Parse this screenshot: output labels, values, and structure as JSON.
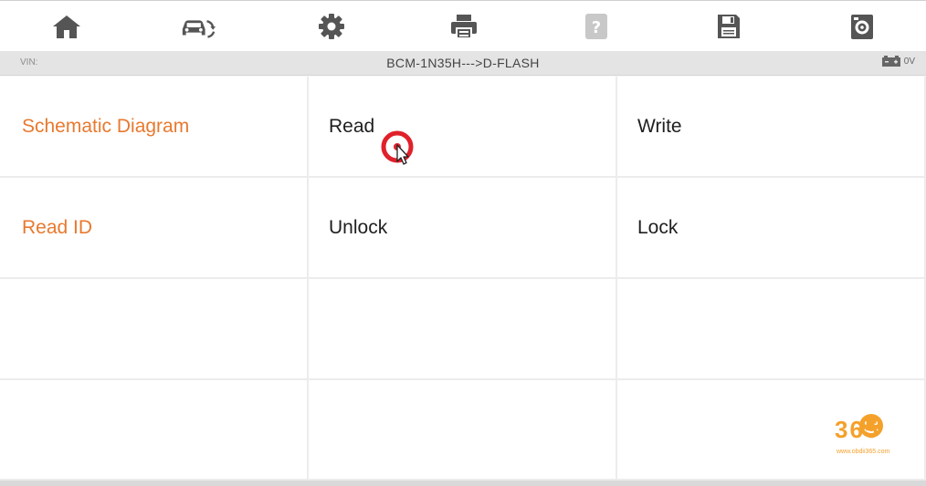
{
  "toolbar": {
    "items": [
      {
        "name": "home-icon",
        "enabled": true
      },
      {
        "name": "vehicle-swap-icon",
        "enabled": true
      },
      {
        "name": "settings-gear-icon",
        "enabled": true
      },
      {
        "name": "printer-icon",
        "enabled": true
      },
      {
        "name": "help-icon",
        "enabled": false
      },
      {
        "name": "save-floppy-icon",
        "enabled": true
      },
      {
        "name": "screenshot-icon",
        "enabled": true
      }
    ]
  },
  "status": {
    "vin_label": "VIN:",
    "path": "BCM-1N35H--->D-FLASH",
    "voltage": "0V",
    "battery_icon": "battery-icon"
  },
  "grid": {
    "rows": [
      [
        "Schematic Diagram",
        "Read",
        "Write"
      ],
      [
        "Read ID",
        "Unlock",
        "Lock"
      ],
      [
        "",
        "",
        ""
      ],
      [
        "",
        "",
        ""
      ]
    ]
  },
  "watermark": {
    "digits": "365",
    "url": "www.obdii365.com"
  },
  "colors": {
    "accent": "#e8792f",
    "toolbar_icon": "#555555",
    "toolbar_icon_disabled": "#c8c8c8",
    "touch_indicator": "#e0202a"
  }
}
